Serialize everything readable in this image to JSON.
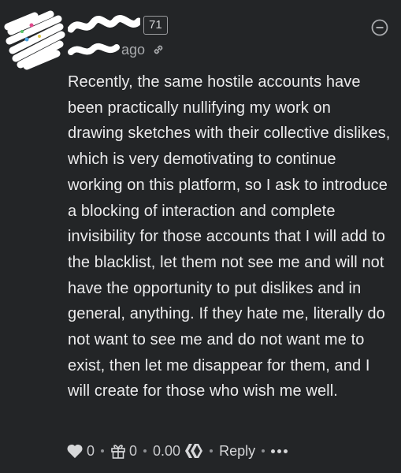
{
  "comment": {
    "reputation": "71",
    "time_suffix": "ago",
    "body": "Recently, the same hostile accounts have been practically nullifying my work on drawing sketches with their collective dislikes, which is very demotivating to continue working on this platform, so I ask to introduce a blocking of interaction and complete invisibility for those accounts that I will add to the blacklist, let them not see me and will not have the opportunity to put dislikes and in general, anything. If they hate me, literally do not want to see me and do not want me to exist, then let me disappear for them, and I will create for those who wish me well."
  },
  "actions": {
    "votes": "0",
    "gifts": "0",
    "payout": "0.00",
    "reply_label": "Reply"
  },
  "colors": {
    "background": "#232527",
    "text": "#ececed",
    "muted": "#a9abae"
  }
}
